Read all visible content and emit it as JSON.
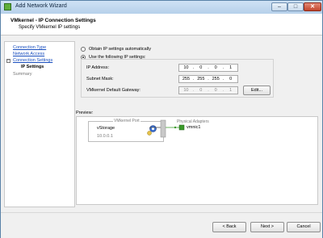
{
  "window": {
    "title": "Add Network Wizard",
    "min_glyph": "–",
    "max_glyph": "□",
    "close_glyph": "✕"
  },
  "header": {
    "title": "VMkernel - IP Connection Settings",
    "subtitle": "Specify VMkernel IP settings"
  },
  "nav": {
    "items": [
      {
        "label": "Connection Type",
        "state": "link"
      },
      {
        "label": "Network Access",
        "state": "link"
      },
      {
        "label": "Connection Settings",
        "state": "link"
      },
      {
        "label": "IP Settings",
        "state": "current"
      },
      {
        "label": "Summary",
        "state": "future"
      }
    ],
    "expander_glyph": "−"
  },
  "ip_settings": {
    "auto_label": "Obtain IP settings automatically",
    "manual_label": "Use the following IP settings:",
    "ip_label": "IP Address:",
    "ip": [
      "10",
      "0",
      "0",
      "1"
    ],
    "subnet_label": "Subnet Mask:",
    "subnet": [
      "255",
      "255",
      "255",
      "0"
    ],
    "gateway_label": "VMkernel Default Gateway:",
    "gateway": [
      "10",
      "0",
      "0",
      "1"
    ],
    "edit_label": "Edit..."
  },
  "preview": {
    "label": "Preview:",
    "vport_label": "VMkernel Port",
    "port_name": "vStorage",
    "port_ip": "10.0.0.1",
    "adapters_label": "Physical Adapters",
    "nic": "vmnic1"
  },
  "footer": {
    "back": "< Back",
    "next": "Next >",
    "cancel": "Cancel"
  },
  "colors": {
    "link": "#1a4fbf",
    "title_gradient_top": "#cfe2f5",
    "nic_green": "#3a9a2a"
  }
}
